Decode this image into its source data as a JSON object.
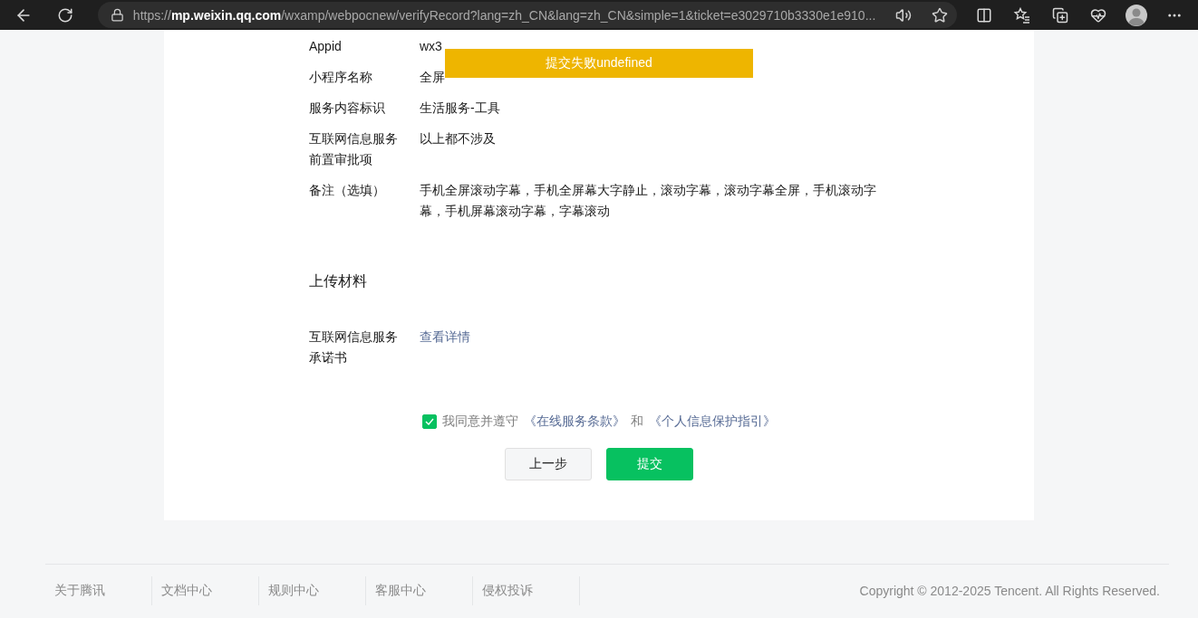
{
  "browser": {
    "url": "https://**mp.weixin.qq.com**/wxamp/webpocnew/verifyRecord?lang=zh_CN&lang=zh_CN&simple=1&ticket=e3029710b3330e1e910..."
  },
  "toast": {
    "text": "提交失败undefined"
  },
  "details": [
    {
      "label": "Appid",
      "value": "wx3"
    },
    {
      "label": "小程序名称",
      "value": "全屏"
    },
    {
      "label": "服务内容标识",
      "value": "生活服务-工具"
    },
    {
      "label": "互联网信息服务前置审批项",
      "value": "以上都不涉及"
    },
    {
      "label": "备注（选填）",
      "value": "手机全屏滚动字幕，手机全屏幕大字静止，滚动字幕，滚动字幕全屏，手机滚动字幕，手机屏幕滚动字幕，字幕滚动"
    }
  ],
  "upload_section": {
    "title": "上传材料",
    "items": [
      {
        "label": "互联网信息服务承诺书",
        "link": "查看详情"
      }
    ]
  },
  "agreement": {
    "checked": true,
    "text": "我同意并遵守",
    "first_link": "《在线服务条款》",
    "joiner": "和",
    "second_link": "《个人信息保护指引》"
  },
  "buttons": [
    {
      "label": "上一步",
      "kind": "secondary"
    },
    {
      "label": "提交",
      "kind": "primary"
    }
  ],
  "footer": {
    "links": [
      "关于腾讯",
      "文档中心",
      "规则中心",
      "客服中心",
      "侵权投诉"
    ],
    "copyright": "Copyright © 2012-2025 Tencent. All Rights Reserved."
  }
}
